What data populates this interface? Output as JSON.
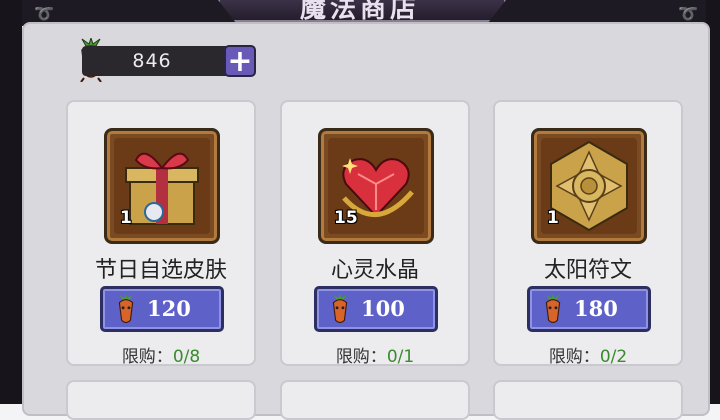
{
  "header": {
    "title": "魔法商店"
  },
  "currency": {
    "amount": "846",
    "icon": "carrot-icon",
    "add_icon": "plus-icon"
  },
  "items": [
    {
      "name": "节日自选皮肤",
      "quantity": "1",
      "price": "120",
      "limit_label": "限购：",
      "limit_count": "0/8",
      "icon": "gift-box-icon"
    },
    {
      "name": "心灵水晶",
      "quantity": "15",
      "price": "100",
      "limit_label": "限购：",
      "limit_count": "0/1",
      "icon": "heart-crystal-icon"
    },
    {
      "name": "太阳符文",
      "quantity": "1",
      "price": "180",
      "limit_label": "限购：",
      "limit_count": "0/2",
      "icon": "sun-rune-icon"
    }
  ],
  "colors": {
    "price_button": "#5d61c8",
    "limit_count": "#3a8a2e",
    "frame": "#17141c"
  }
}
